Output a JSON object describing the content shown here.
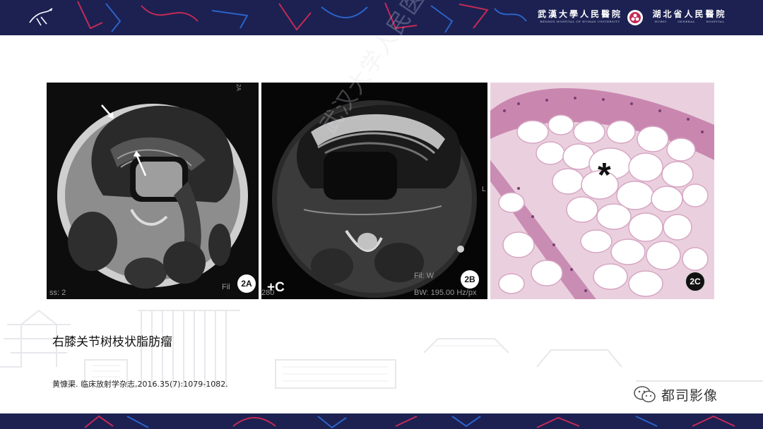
{
  "header": {
    "hospital_1": "武漢大學人民醫院",
    "hospital_1_en": "RENMIN HOSPITAL OF WUHAN UNIVERSITY",
    "hospital_2": "湖北省人民醫院",
    "hospital_2_en": "HUBEI GENERAL HOSPITAL"
  },
  "figure": {
    "panels": [
      {
        "label": "2A",
        "corner_text": "2A",
        "bottom_text": "ss: 2",
        "side_text": "Fil"
      },
      {
        "label": "2B",
        "bottom_text": "BW: 195.00 Hz/px",
        "side_text": "Fil: W",
        "marker_text": "L",
        "overlay_left": "280"
      },
      {
        "label": "2C",
        "symbol": "*"
      }
    ],
    "contrast_label": "+C"
  },
  "watermark": "武汉大学人民医院放射科",
  "caption": "右膝关节树枝状脂肪瘤",
  "reference": "黄慷渠. 临床放射学杂志,2016.35(7):1079-1082.",
  "brand": {
    "name": "都司影像"
  },
  "colors": {
    "header_bg": "#1c2152",
    "accent_red": "#c42a55",
    "accent_blue": "#2b63c8",
    "histology_pink": "#ead0de"
  }
}
